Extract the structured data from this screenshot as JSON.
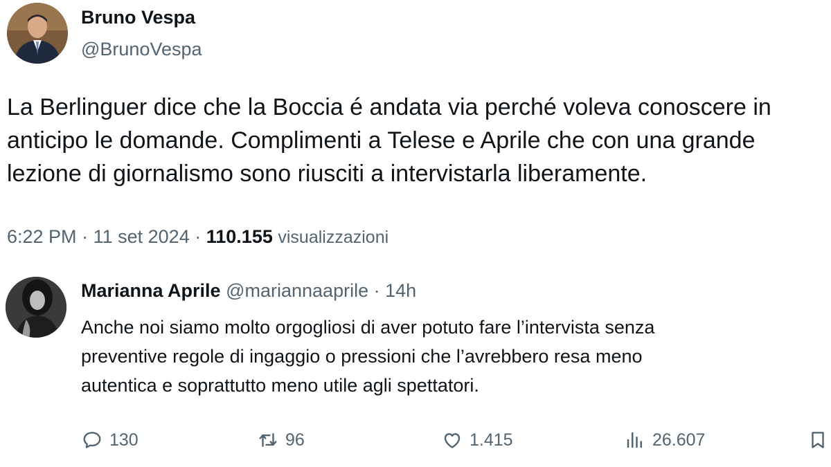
{
  "tweet": {
    "author_name": "Bruno Vespa",
    "author_handle": "@BrunoVespa",
    "text_lines": [
      "La Berlinguer dice che la Boccia é andata via perché voleva conoscere in",
      "anticipo le domande. Complimenti a Telese e Aprile che con una grande",
      "lezione di giornalismo sono riusciti a intervistarla liberamente."
    ],
    "time": "6:22 PM",
    "separator": "·",
    "date": "11 set 2024",
    "views_count": "110.155",
    "views_label": "visualizzazioni"
  },
  "reply": {
    "author_name": "Marianna Aprile",
    "author_handle": "@mariannaaprile",
    "separator": "·",
    "time_ago": "14h",
    "text_lines": [
      "Anche noi siamo molto orgogliosi di aver potuto fare l’intervista senza",
      "preventive regole di ingaggio o pressioni che l’avrebbero resa meno",
      "autentica e soprattutto meno utile agli spettatori."
    ],
    "actions": {
      "replies": "130",
      "reposts": "96",
      "likes": "1.415",
      "views": "26.607"
    }
  },
  "icons": {
    "reply": "speech-bubble-icon",
    "repost": "repost-arrows-icon",
    "like": "heart-icon",
    "views": "bar-chart-icon",
    "bookmark": "bookmark-icon"
  },
  "colors": {
    "text_primary": "#0f1419",
    "text_secondary": "#536471",
    "background": "#ffffff"
  }
}
